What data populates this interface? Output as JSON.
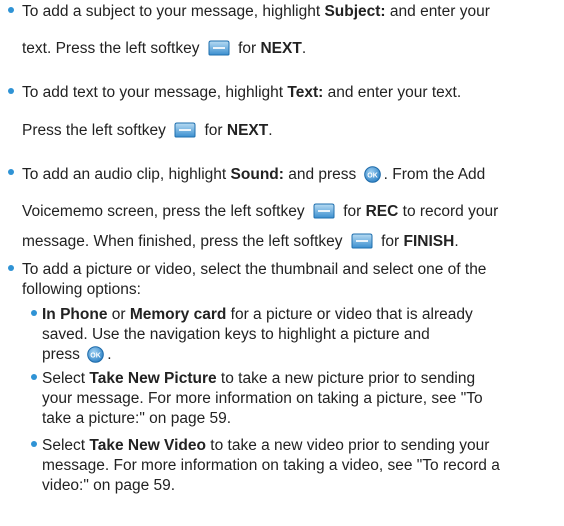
{
  "bullet_color": "#2f93d5",
  "items": [
    {
      "lines": [
        [
          {
            "t": "To add a subject to your message, highlight "
          },
          {
            "t": "Subject:",
            "b": true
          },
          {
            "t": " and enter your"
          }
        ],
        [
          {
            "t": "text. Press the left softkey "
          },
          {
            "icon": "softkey-icon"
          },
          {
            "t": " for "
          },
          {
            "t": "NEXT",
            "b": true
          },
          {
            "t": "."
          }
        ]
      ]
    },
    {
      "lines": [
        [
          {
            "t": "To add text to your message, highlight "
          },
          {
            "t": "Text:",
            "b": true
          },
          {
            "t": " and enter your text."
          }
        ],
        [
          {
            "t": "Press the left softkey "
          },
          {
            "icon": "softkey-icon"
          },
          {
            "t": " for "
          },
          {
            "t": "NEXT",
            "b": true
          },
          {
            "t": "."
          }
        ]
      ]
    },
    {
      "lines": [
        [
          {
            "t": "To add an audio clip, highlight "
          },
          {
            "t": "Sound:",
            "b": true
          },
          {
            "t": " and press "
          },
          {
            "icon": "ok-button-icon"
          },
          {
            "t": ". From the Add"
          }
        ],
        [
          {
            "t": "Voicememo screen, press the left softkey "
          },
          {
            "icon": "softkey-icon"
          },
          {
            "t": " for "
          },
          {
            "t": "REC",
            "b": true
          },
          {
            "t": " to record your"
          }
        ],
        [
          {
            "t": "message. When finished, press the left softkey "
          },
          {
            "icon": "softkey-icon"
          },
          {
            "t": " for "
          },
          {
            "t": "FINISH",
            "b": true
          },
          {
            "t": "."
          }
        ]
      ]
    },
    {
      "lines": [
        [
          {
            "t": "To add a picture or video, select the thumbnail and select one of the"
          }
        ],
        [
          {
            "t": "following options:"
          }
        ]
      ]
    }
  ],
  "subitems": [
    {
      "lines": [
        [
          {
            "t": "In Phone",
            "b": true
          },
          {
            "t": " or "
          },
          {
            "t": "Memory card",
            "b": true
          },
          {
            "t": " for a picture or video that is already"
          }
        ],
        [
          {
            "t": "saved. Use the navigation keys to highlight a picture and"
          }
        ],
        [
          {
            "t": "press "
          },
          {
            "icon": "ok-button-icon"
          },
          {
            "t": "."
          }
        ]
      ]
    },
    {
      "lines": [
        [
          {
            "t": "Select "
          },
          {
            "t": "Take New Picture",
            "b": true
          },
          {
            "t": " to take a new picture prior to sending"
          }
        ],
        [
          {
            "t": "your message. For more information on taking a picture, see \"To"
          }
        ],
        [
          {
            "t": "take a picture:\" on page 59."
          }
        ]
      ]
    },
    {
      "lines": [
        [
          {
            "t": "Select "
          },
          {
            "t": "Take New Video",
            "b": true
          },
          {
            "t": " to take a new video prior to sending your"
          }
        ],
        [
          {
            "t": "message. For more information on taking a video, see \"To record a"
          }
        ],
        [
          {
            "t": "video:\" on page 59."
          }
        ]
      ]
    }
  ]
}
